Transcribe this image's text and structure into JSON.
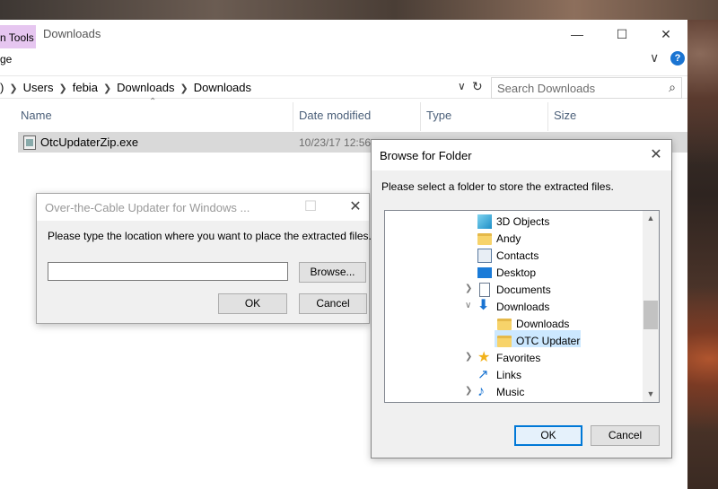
{
  "explorer": {
    "contextual_tab": "n Tools",
    "title": "Downloads",
    "ribbon_tab": "ge",
    "address": [
      "Users",
      "febia",
      "Downloads",
      "Downloads"
    ],
    "address_lead": ")",
    "search_placeholder": "Search Downloads",
    "columns": [
      "Name",
      "Date modified",
      "Type",
      "Size"
    ],
    "files": [
      {
        "name": "OtcUpdaterZip.exe",
        "date": "10/23/17 12:56"
      }
    ]
  },
  "updater_dialog": {
    "title": "Over-the-Cable Updater for Windows ...",
    "message": "Please type the location where you want to place the extracted files.",
    "path_value": "",
    "browse_label": "Browse...",
    "ok_label": "OK",
    "cancel_label": "Cancel"
  },
  "browse_dialog": {
    "title": "Browse for Folder",
    "message": "Please select a folder to store the extracted files.",
    "tree": [
      {
        "label": "3D Objects",
        "icon": "cube-icon",
        "expander": ""
      },
      {
        "label": "Andy",
        "icon": "user-folder-icon",
        "expander": ""
      },
      {
        "label": "Contacts",
        "icon": "contacts-icon",
        "expander": ""
      },
      {
        "label": "Desktop",
        "icon": "desktop-icon",
        "expander": ""
      },
      {
        "label": "Documents",
        "icon": "documents-icon",
        "expander": ">"
      },
      {
        "label": "Downloads",
        "icon": "downloads-icon",
        "expander": "v"
      },
      {
        "label": "Downloads",
        "icon": "folder-icon",
        "expander": "",
        "child": true
      },
      {
        "label": "OTC Updater",
        "icon": "folder-icon",
        "expander": "",
        "child": true,
        "selected": true
      },
      {
        "label": "Favorites",
        "icon": "star-icon",
        "expander": ">"
      },
      {
        "label": "Links",
        "icon": "links-icon",
        "expander": ""
      },
      {
        "label": "Music",
        "icon": "music-icon",
        "expander": ">"
      }
    ],
    "ok_label": "OK",
    "cancel_label": "Cancel"
  },
  "colors": {
    "accent": "#0078d7",
    "selection": "#cce8ff",
    "contextual_tab": "#e6c6f0"
  }
}
